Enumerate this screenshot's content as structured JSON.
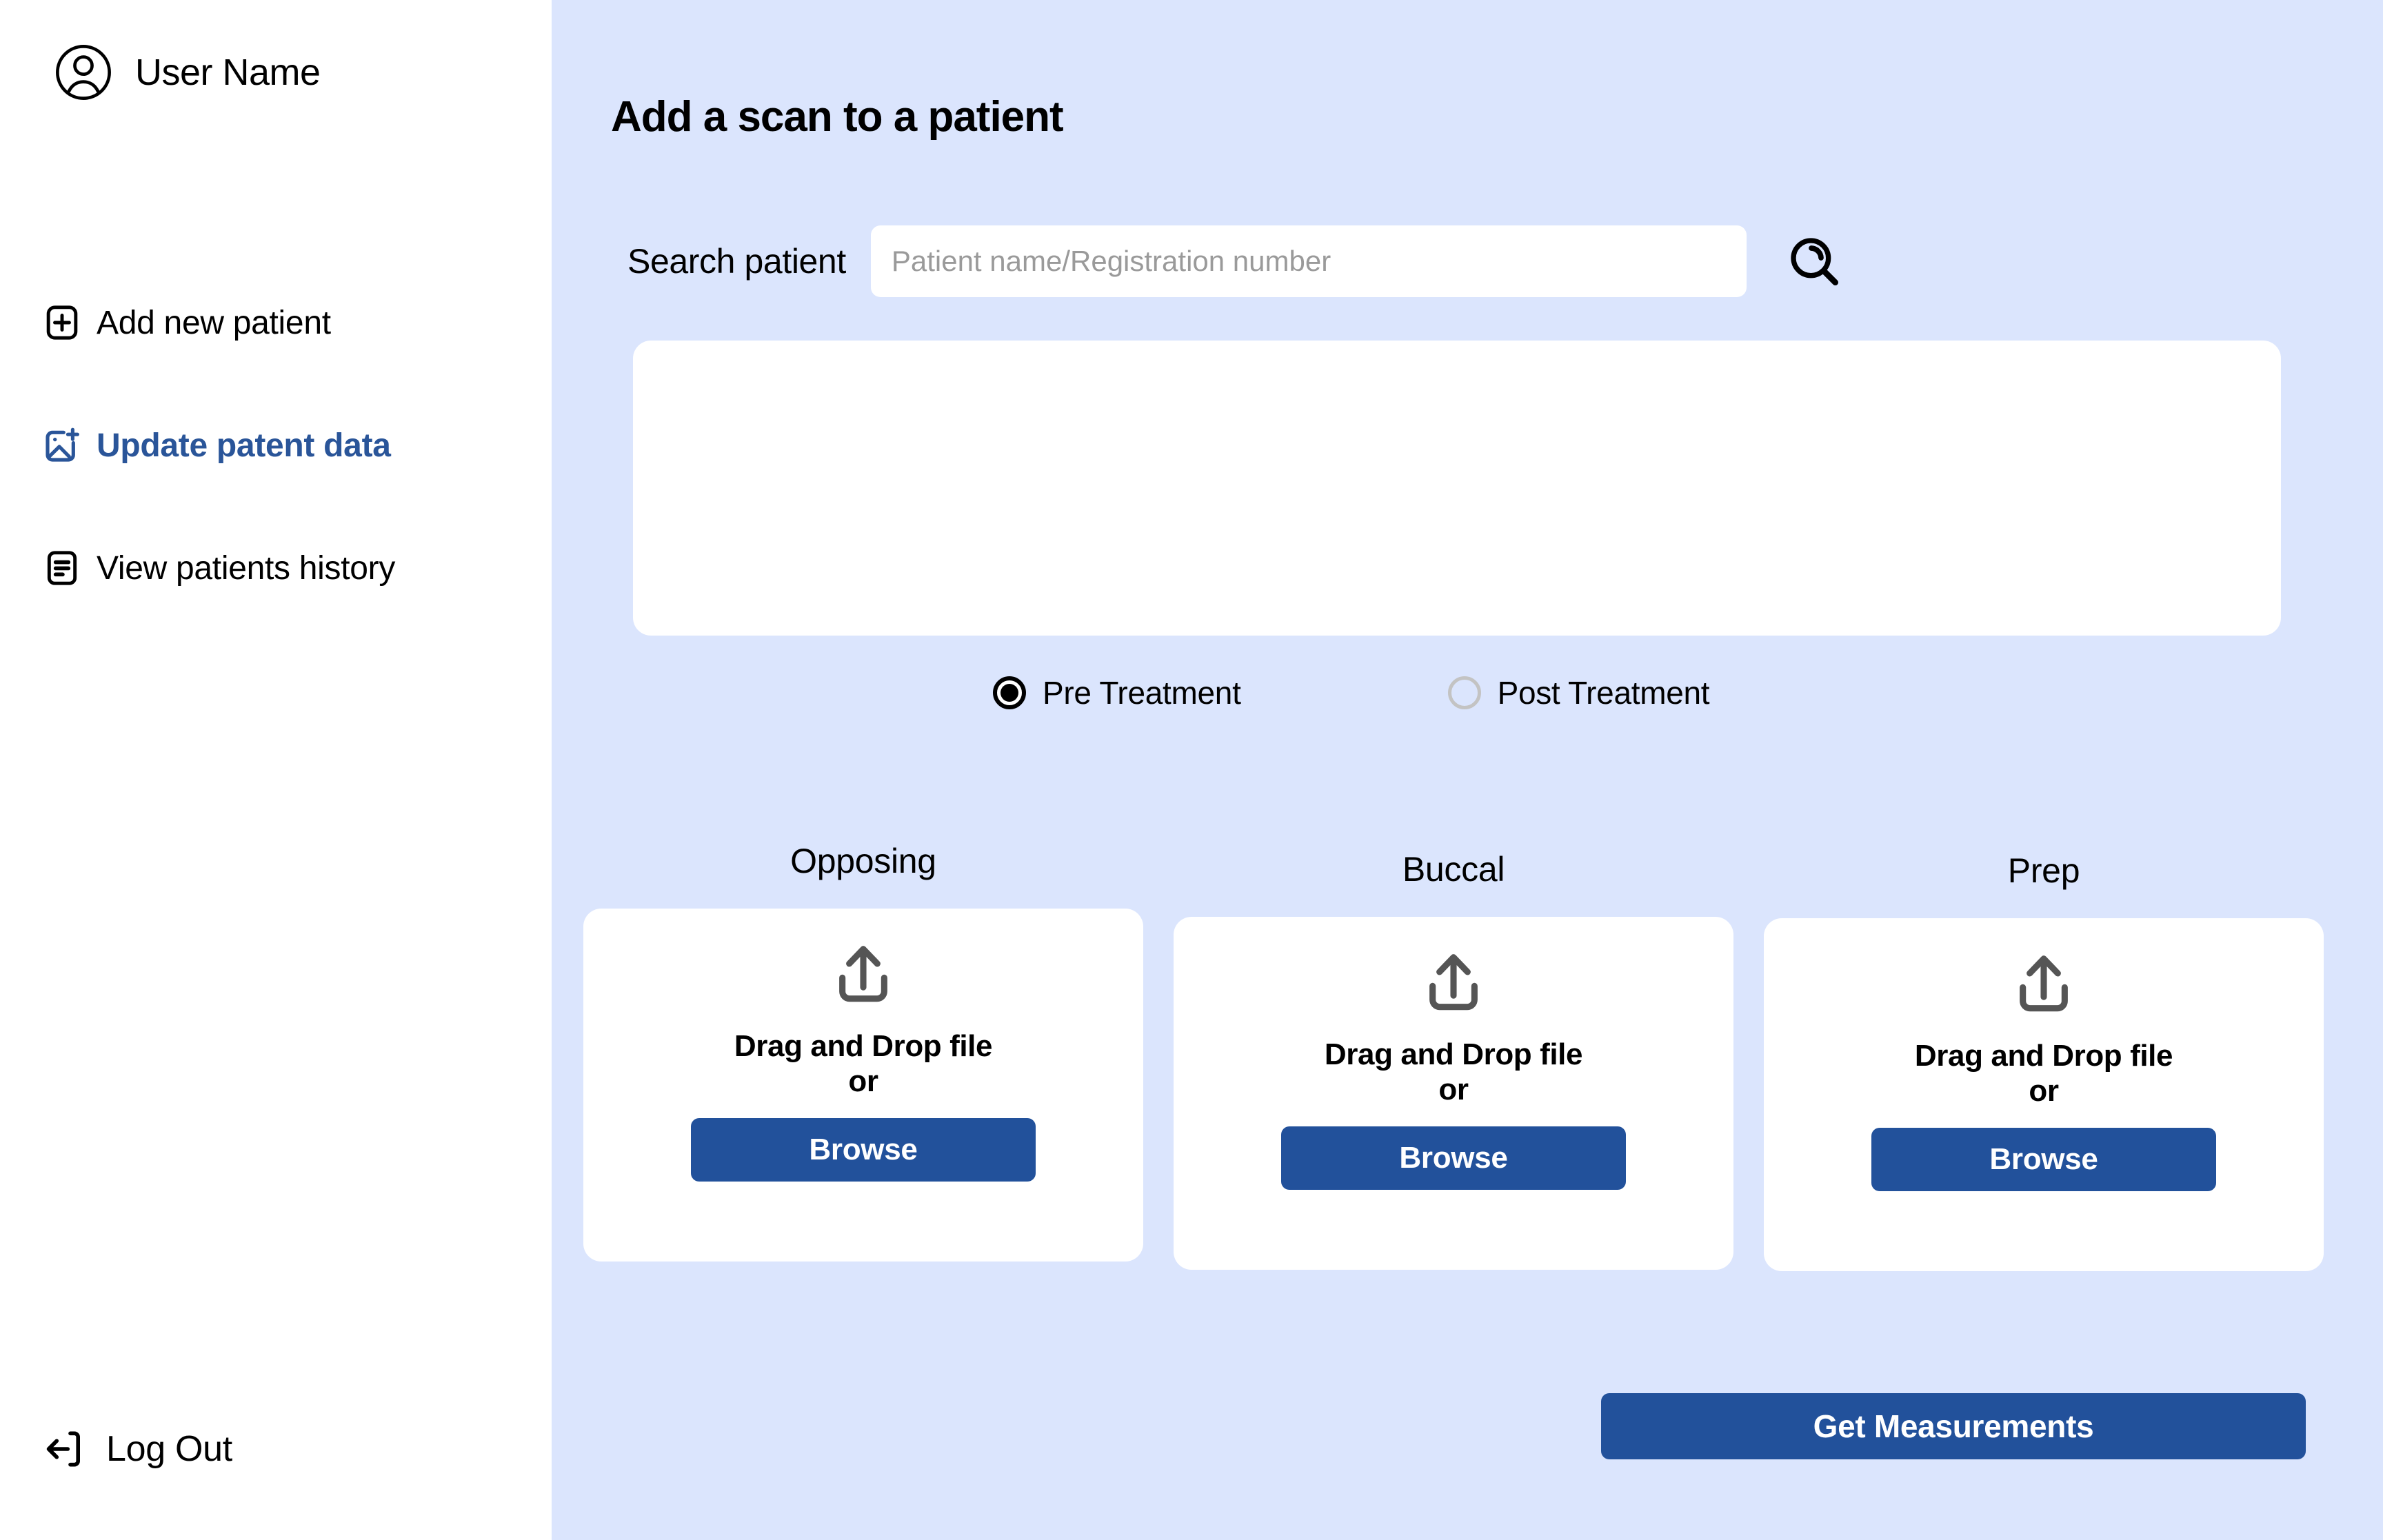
{
  "sidebar": {
    "user": {
      "name": "User Name",
      "avatar_icon": "user-circle-icon"
    },
    "items": [
      {
        "label": "Add new patient",
        "icon": "plus-square-icon",
        "active": false
      },
      {
        "label": "Update patent data",
        "icon": "image-plus-icon",
        "active": true
      },
      {
        "label": "View patients history",
        "icon": "document-list-icon",
        "active": false
      }
    ],
    "logout": {
      "label": "Log Out",
      "icon": "logout-arrow-icon"
    }
  },
  "main": {
    "title": "Add a scan to a patient",
    "search": {
      "label": "Search patient",
      "value": "",
      "placeholder": "Patient name/Registration number",
      "icon": "search-icon"
    },
    "results_panel": {
      "content": ""
    },
    "treatment": {
      "options": [
        {
          "label": "Pre Treatment",
          "selected": true
        },
        {
          "label": "Post Treatment",
          "selected": false
        }
      ]
    },
    "uploads": [
      {
        "title": "Opposing",
        "dragdrop": "Drag and Drop file",
        "or": "or",
        "browse": "Browse",
        "icon": "upload-arrow-icon"
      },
      {
        "title": "Buccal",
        "dragdrop": "Drag and Drop file",
        "or": "or",
        "browse": "Browse",
        "icon": "upload-arrow-icon"
      },
      {
        "title": "Prep",
        "dragdrop": "Drag and Drop file",
        "or": "or",
        "browse": "Browse",
        "icon": "upload-arrow-icon"
      }
    ],
    "get_measurements_label": "Get Measurements"
  },
  "colors": {
    "accent_blue": "#2A5599",
    "button_blue": "#22519B",
    "main_background": "#DBE5FD",
    "sidebar_background": "#FFFFFF",
    "placeholder_gray": "#9A9A9A",
    "radio_off_gray": "#C3C3C3",
    "upload_icon_gray": "#555555"
  }
}
